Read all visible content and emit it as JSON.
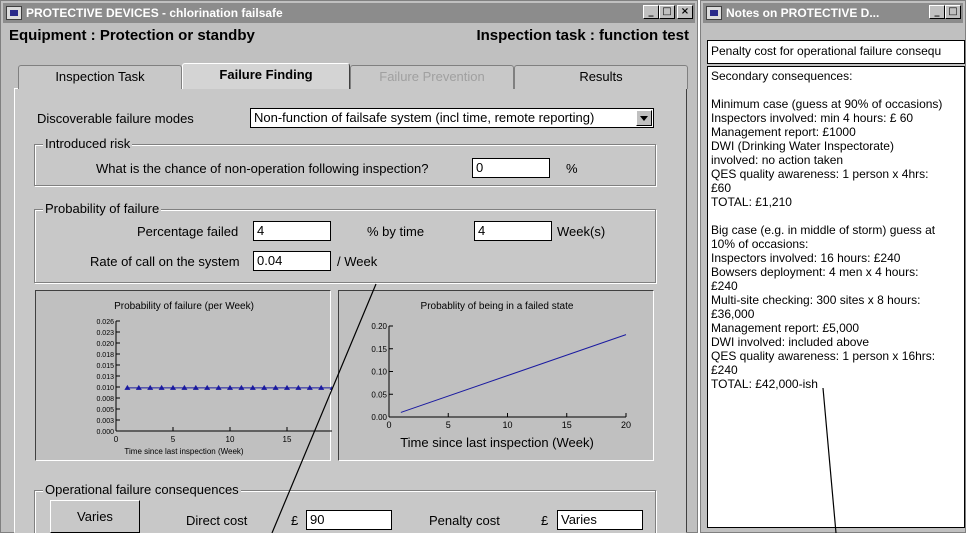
{
  "main_window": {
    "title": "PROTECTIVE DEVICES - chlorination failsafe",
    "equipment_label": "Equipment :  Protection or standby",
    "inspection_task_label": "Inspection task : function test",
    "tabs": [
      {
        "label": "Inspection Task"
      },
      {
        "label": "Failure Finding"
      },
      {
        "label": "Failure Prevention"
      },
      {
        "label": "Results"
      }
    ],
    "discoverable_failure_modes_label": "Discoverable failure modes",
    "discoverable_failure_modes_value": "Non-function of failsafe system (incl time, remote reporting)",
    "introduced_risk": {
      "title": "Introduced risk",
      "question": "What is the chance of non-operation following inspection?",
      "value": "0",
      "unit": "%"
    },
    "probability_of_failure": {
      "title": "Probability of failure",
      "percentage_failed_label": "Percentage failed",
      "percentage_failed_value": "4",
      "by_time_label": "%  by time",
      "by_time_value": "4",
      "by_time_unit": "Week(s)",
      "rate_label": "Rate of call on the system",
      "rate_value": "0.04",
      "rate_unit": "/ Week"
    },
    "operational_failure": {
      "title": "Operational failure consequences",
      "varies_button": "Varies",
      "direct_cost_label": "Direct cost",
      "currency": "£",
      "direct_cost_value": "90",
      "penalty_cost_label": "Penalty cost",
      "penalty_cost_value": "Varies"
    }
  },
  "notes_window": {
    "title": "Notes on PROTECTIVE D...",
    "header_field": "Penalty cost for operational failure consequ",
    "lines": [
      "Secondary consequences:",
      "",
      "Minimum case (guess at 90% of occasions)",
      "Inspectors involved: min 4 hours: £ 60",
      "Management report: £1000",
      "DWI (Drinking Water Inspectorate)",
      "involved: no action taken",
      "QES quality awareness: 1 person x 4hrs:",
      "£60",
      "TOTAL: £1,210",
      "",
      "Big case (e.g. in middle of storm) guess at",
      "10% of occasions:",
      "Inspectors involved: 16 hours: £240",
      "Bowsers deployment: 4 men x 4 hours:",
      "£240",
      "Multi-site checking: 300 sites x 8 hours:",
      "£36,000",
      "Management report: £5,000",
      "DWI involved: included above",
      "QES quality awareness: 1 person x 16hrs:",
      "£240",
      "TOTAL: £42,000-ish"
    ]
  },
  "title_buttons": {
    "minimize": "_",
    "maximize": "□",
    "close": "×"
  },
  "colors": {
    "series": "#1a1aa0",
    "titlebar": "#8c8c8c",
    "window": "#c0c0c0"
  },
  "chart_data": [
    {
      "type": "line",
      "title": "Probability of failure (per Week)",
      "xlabel": "Time since last inspection (Week)",
      "ylabel": "",
      "xlim": [
        0,
        20
      ],
      "ylim": [
        0,
        0.026
      ],
      "xticks": [
        "0",
        "5",
        "10",
        "15",
        "20"
      ],
      "yticks": [
        "0.000",
        "0.003",
        "0.005",
        "0.008",
        "0.010",
        "0.013",
        "0.015",
        "0.018",
        "0.020",
        "0.023",
        "0.026"
      ],
      "ytick_values": [
        0,
        0.0026,
        0.0052,
        0.0078,
        0.0104,
        0.013,
        0.0156,
        0.0182,
        0.0208,
        0.0234,
        0.026
      ],
      "x": [
        1,
        2,
        3,
        4,
        5,
        6,
        7,
        8,
        9,
        10,
        11,
        12,
        13,
        14,
        15,
        16,
        17,
        18,
        19,
        20
      ],
      "values": [
        0.0102,
        0.0102,
        0.0102,
        0.0102,
        0.0102,
        0.0102,
        0.0102,
        0.0102,
        0.0102,
        0.0102,
        0.0102,
        0.0102,
        0.0102,
        0.0102,
        0.0102,
        0.0102,
        0.0102,
        0.0102,
        0.0102,
        0.0102
      ],
      "markers": true
    },
    {
      "type": "line",
      "title": "Probablity of being in a failed state",
      "xlabel": "Time since last inspection (Week)",
      "ylabel": "",
      "xlim": [
        0,
        20
      ],
      "ylim": [
        0,
        0.2
      ],
      "xticks": [
        "0",
        "5",
        "10",
        "15",
        "20"
      ],
      "yticks": [
        "0.00",
        "0.05",
        "0.10",
        "0.15",
        "0.20"
      ],
      "ytick_values": [
        0,
        0.05,
        0.1,
        0.15,
        0.2
      ],
      "x": [
        1,
        20
      ],
      "values": [
        0.01,
        0.181
      ],
      "markers": false
    }
  ]
}
